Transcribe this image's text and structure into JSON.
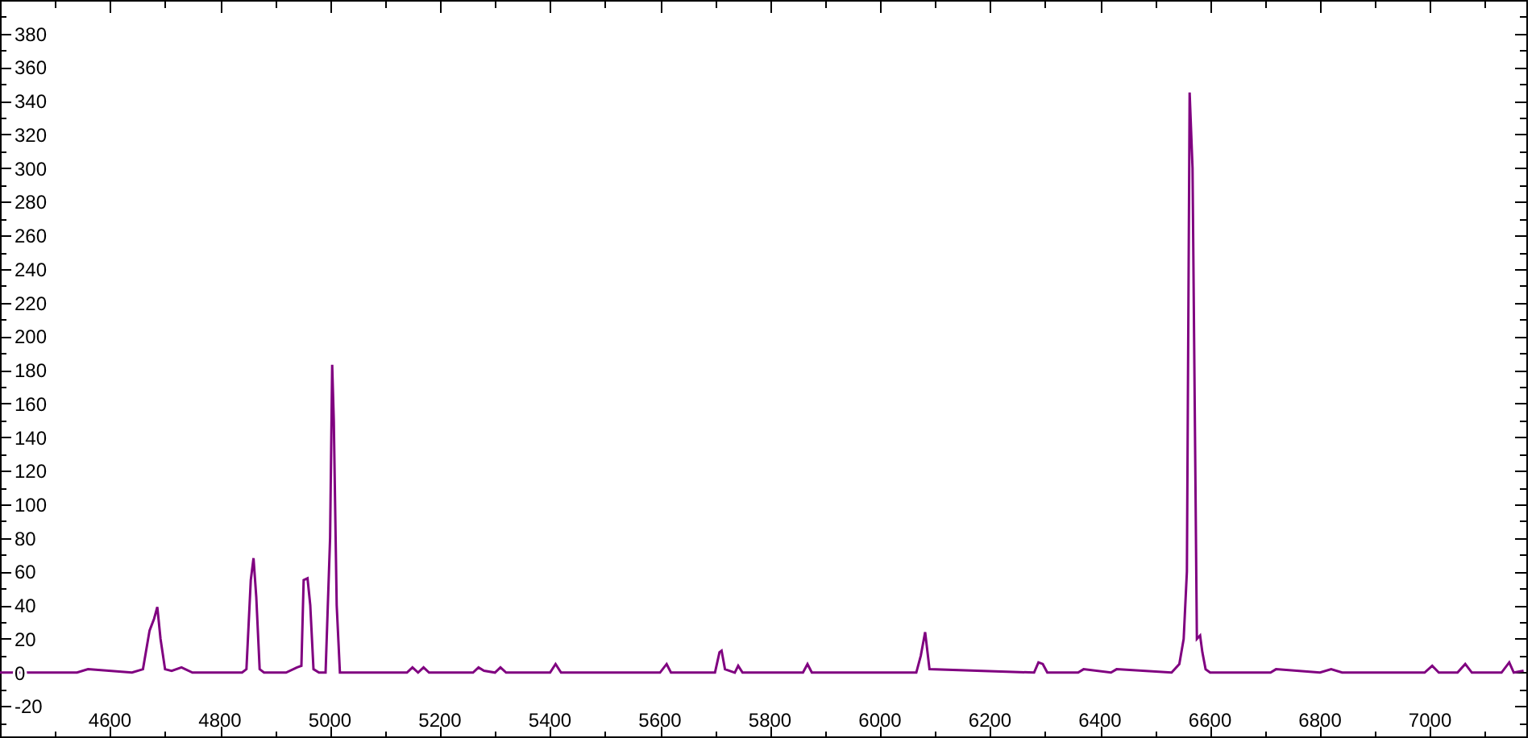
{
  "chart_data": {
    "type": "line",
    "xlim": [
      4400,
      7175
    ],
    "ylim": [
      -38,
      400
    ],
    "xticks": [
      4600,
      4800,
      5000,
      5200,
      5400,
      5600,
      5800,
      6000,
      6200,
      6400,
      6600,
      6800,
      7000
    ],
    "yticks": [
      -20,
      0,
      20,
      40,
      60,
      80,
      100,
      120,
      140,
      160,
      180,
      200,
      220,
      240,
      260,
      280,
      300,
      320,
      340,
      360,
      380
    ],
    "x": [
      4400,
      4500,
      4520,
      4540,
      4560,
      4640,
      4660,
      4672,
      4680,
      4686,
      4692,
      4700,
      4712,
      4730,
      4750,
      4840,
      4848,
      4856,
      4861,
      4866,
      4872,
      4880,
      4920,
      4940,
      4948,
      4952,
      4959,
      4964,
      4970,
      4980,
      4992,
      5000,
      5004,
      5007,
      5012,
      5018,
      5030,
      5140,
      5150,
      5160,
      5170,
      5180,
      5260,
      5270,
      5280,
      5300,
      5310,
      5320,
      5400,
      5410,
      5420,
      5600,
      5612,
      5620,
      5700,
      5708,
      5712,
      5718,
      5736,
      5742,
      5750,
      5860,
      5868,
      5876,
      6066,
      6074,
      6082,
      6090,
      6280,
      6288,
      6296,
      6304,
      6360,
      6370,
      6420,
      6430,
      6530,
      6544,
      6552,
      6558,
      6563,
      6568,
      6576,
      6582,
      6586,
      6592,
      6600,
      6710,
      6720,
      6800,
      6820,
      6840,
      6990,
      7004,
      7016,
      7050,
      7064,
      7076,
      7130,
      7144,
      7152,
      7170
    ],
    "series": [
      {
        "color": "#800080",
        "values": [
          0,
          0,
          0,
          0,
          2,
          0,
          2,
          25,
          32,
          39,
          20,
          2,
          1,
          3,
          0,
          0,
          2,
          55,
          68,
          45,
          2,
          0,
          0,
          3,
          4,
          55,
          56,
          40,
          2,
          0,
          0,
          80,
          183,
          150,
          40,
          0,
          0,
          0,
          3,
          0,
          3,
          0,
          0,
          3,
          1,
          0,
          3,
          0,
          0,
          5,
          0,
          0,
          5,
          0,
          0,
          12,
          13,
          2,
          0,
          4,
          0,
          0,
          5,
          0,
          0,
          10,
          24,
          2,
          0,
          6,
          5,
          0,
          0,
          2,
          0,
          2,
          0,
          5,
          20,
          60,
          345,
          300,
          20,
          22,
          12,
          2,
          0,
          0,
          2,
          0,
          2,
          0,
          0,
          4,
          0,
          0,
          5,
          0,
          0,
          6,
          0,
          1
        ]
      }
    ]
  }
}
